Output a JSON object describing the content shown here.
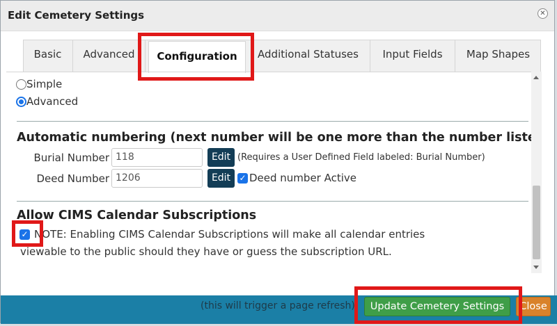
{
  "dialog": {
    "title": "Edit Cemetery Settings",
    "close_icon": "close-circle-icon"
  },
  "tabs": [
    {
      "label": "Basic"
    },
    {
      "label": "Advanced"
    },
    {
      "label": "Configuration",
      "active": true
    },
    {
      "label": "Additional Statuses"
    },
    {
      "label": "Input Fields"
    },
    {
      "label": "Map Shapes"
    }
  ],
  "mode": {
    "options": [
      {
        "label": "Simple",
        "checked": false
      },
      {
        "label": "Advanced",
        "checked": true
      }
    ]
  },
  "numbering": {
    "heading": "Automatic numbering (next number will be one more than the number listed below)",
    "burial": {
      "label": "Burial Number",
      "value": "118",
      "edit_label": "Edit",
      "note": "(Requires a User Defined Field labeled: Burial Number)"
    },
    "deed": {
      "label": "Deed Number",
      "value": "1206",
      "edit_label": "Edit",
      "active_label": "Deed number Active",
      "active_checked": true
    }
  },
  "calendar": {
    "heading": "Allow CIMS Calendar Subscriptions",
    "checked": true,
    "note_line1": "NOTE: Enabling CIMS Calendar Subscriptions will make all calendar entries",
    "note_line2": "viewable to the public should they have or guess the subscription URL."
  },
  "footer": {
    "note": "(this will trigger a page refresh)",
    "update_label": "Update Cemetery Settings",
    "close_label": "Close"
  },
  "colors": {
    "footer_bg": "#1b7fa6",
    "update_button": "#3f9e48",
    "close_button": "#d9822b",
    "edit_button": "#133d56",
    "highlight": "#e01818",
    "checkbox": "#1a73e8"
  }
}
